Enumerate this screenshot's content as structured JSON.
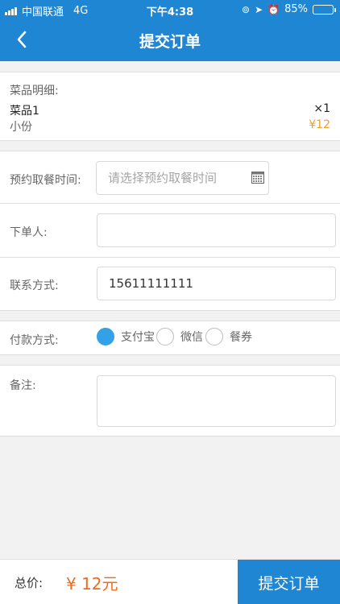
{
  "status_bar": {
    "carrier": "中国联通",
    "network": "4G",
    "time": "下午4:38",
    "battery_percent": "85%",
    "battery_level": 0.85
  },
  "nav": {
    "title": "提交订单",
    "back_icon": "chevron-left-icon"
  },
  "order_items": {
    "header": "菜品明细:",
    "items": [
      {
        "name": "菜品1",
        "quantity": "×1",
        "size": "小份",
        "price": "¥12"
      }
    ]
  },
  "form": {
    "pickup_time": {
      "label": "预约取餐时间:",
      "placeholder": "请选择预约取餐时间",
      "value": "",
      "icon": "calendar-icon"
    },
    "orderer": {
      "label": "下单人:",
      "value": ""
    },
    "contact": {
      "label": "联系方式:",
      "value": "15611111111"
    },
    "payment": {
      "label": "付款方式:",
      "options": [
        {
          "label": "支付宝",
          "selected": true
        },
        {
          "label": "微信",
          "selected": false
        },
        {
          "label": "餐券",
          "selected": false
        }
      ]
    },
    "notes": {
      "label": "备注:",
      "value": ""
    }
  },
  "footer": {
    "total_label": "总价:",
    "total_value": "¥ 12元",
    "submit_label": "提交订单"
  },
  "colors": {
    "brand_blue": "#1f86d3",
    "radio_selected": "#33a1e6",
    "price_orange": "#f39c2c",
    "total_orange": "#f26a1b"
  }
}
